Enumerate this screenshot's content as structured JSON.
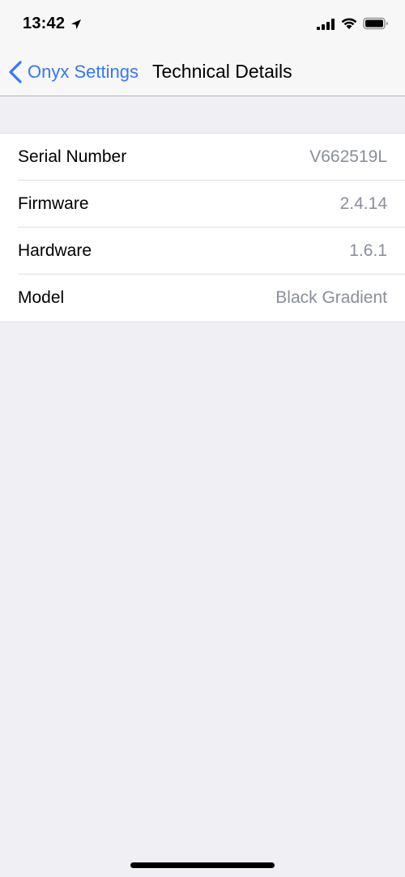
{
  "status_bar": {
    "time": "13:42",
    "icons": [
      "location-arrow-icon",
      "cellular-signal-icon",
      "wifi-icon",
      "battery-icon"
    ]
  },
  "nav": {
    "back_label": "Onyx Settings",
    "back_icon": "chevron-left-icon",
    "title": "Technical Details",
    "accent_color": "#3478F6"
  },
  "details": {
    "rows": [
      {
        "label": "Serial Number",
        "value": "V662519L"
      },
      {
        "label": "Firmware",
        "value": "2.4.14"
      },
      {
        "label": "Hardware",
        "value": "1.6.1"
      },
      {
        "label": "Model",
        "value": "Black Gradient"
      }
    ]
  },
  "colors": {
    "background": "#EFEFF4",
    "value_text": "#8A8F99",
    "cell_background": "#FFFFFF"
  }
}
